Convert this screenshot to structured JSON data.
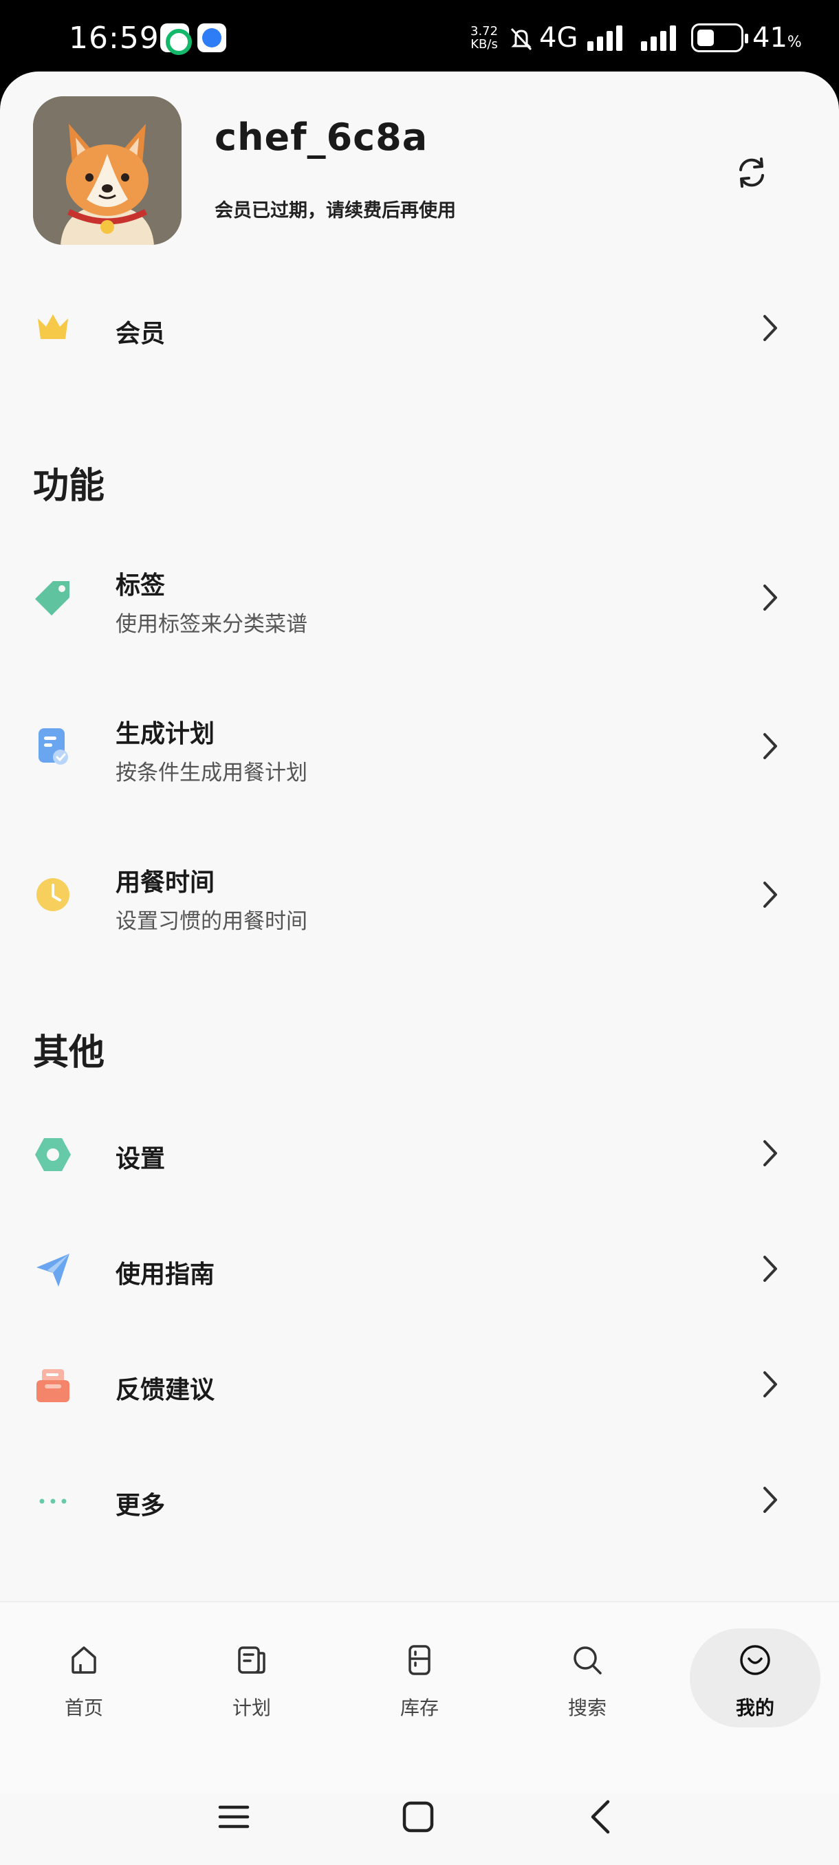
{
  "status_bar": {
    "time": "16:59",
    "speed_value": "3.72",
    "speed_unit": "KB/s",
    "network": "4G",
    "battery": "41",
    "battery_unit": "%"
  },
  "profile": {
    "username": "chef_6c8a",
    "status": "会员已过期，请续费后再使用"
  },
  "membership": {
    "label": "会员",
    "icon": "crown-icon"
  },
  "features": {
    "title": "功能",
    "items": [
      {
        "label": "标签",
        "sub": "使用标签来分类菜谱",
        "icon": "tag-icon",
        "color": "#5fc3a0"
      },
      {
        "label": "生成计划",
        "sub": "按条件生成用餐计划",
        "icon": "plan-document-icon",
        "color": "#6aa6f0"
      },
      {
        "label": "用餐时间",
        "sub": "设置习惯的用餐时间",
        "icon": "clock-icon",
        "color": "#f6cf5c"
      }
    ]
  },
  "others": {
    "title": "其他",
    "items": [
      {
        "label": "设置",
        "icon": "settings-hexagon-icon",
        "color": "#66c9a8"
      },
      {
        "label": "使用指南",
        "icon": "paper-plane-icon",
        "color": "#6aa6f0"
      },
      {
        "label": "反馈建议",
        "icon": "feedback-tray-icon",
        "color": "#f4846a"
      },
      {
        "label": "更多",
        "icon": "more-dots-icon",
        "color": "#66c9a8"
      }
    ]
  },
  "bottom_nav": {
    "items": [
      {
        "label": "首页",
        "icon": "home-icon"
      },
      {
        "label": "计划",
        "icon": "plan-icon"
      },
      {
        "label": "库存",
        "icon": "fridge-icon"
      },
      {
        "label": "搜索",
        "icon": "search-icon"
      },
      {
        "label": "我的",
        "icon": "smiley-icon",
        "active": true
      }
    ]
  }
}
